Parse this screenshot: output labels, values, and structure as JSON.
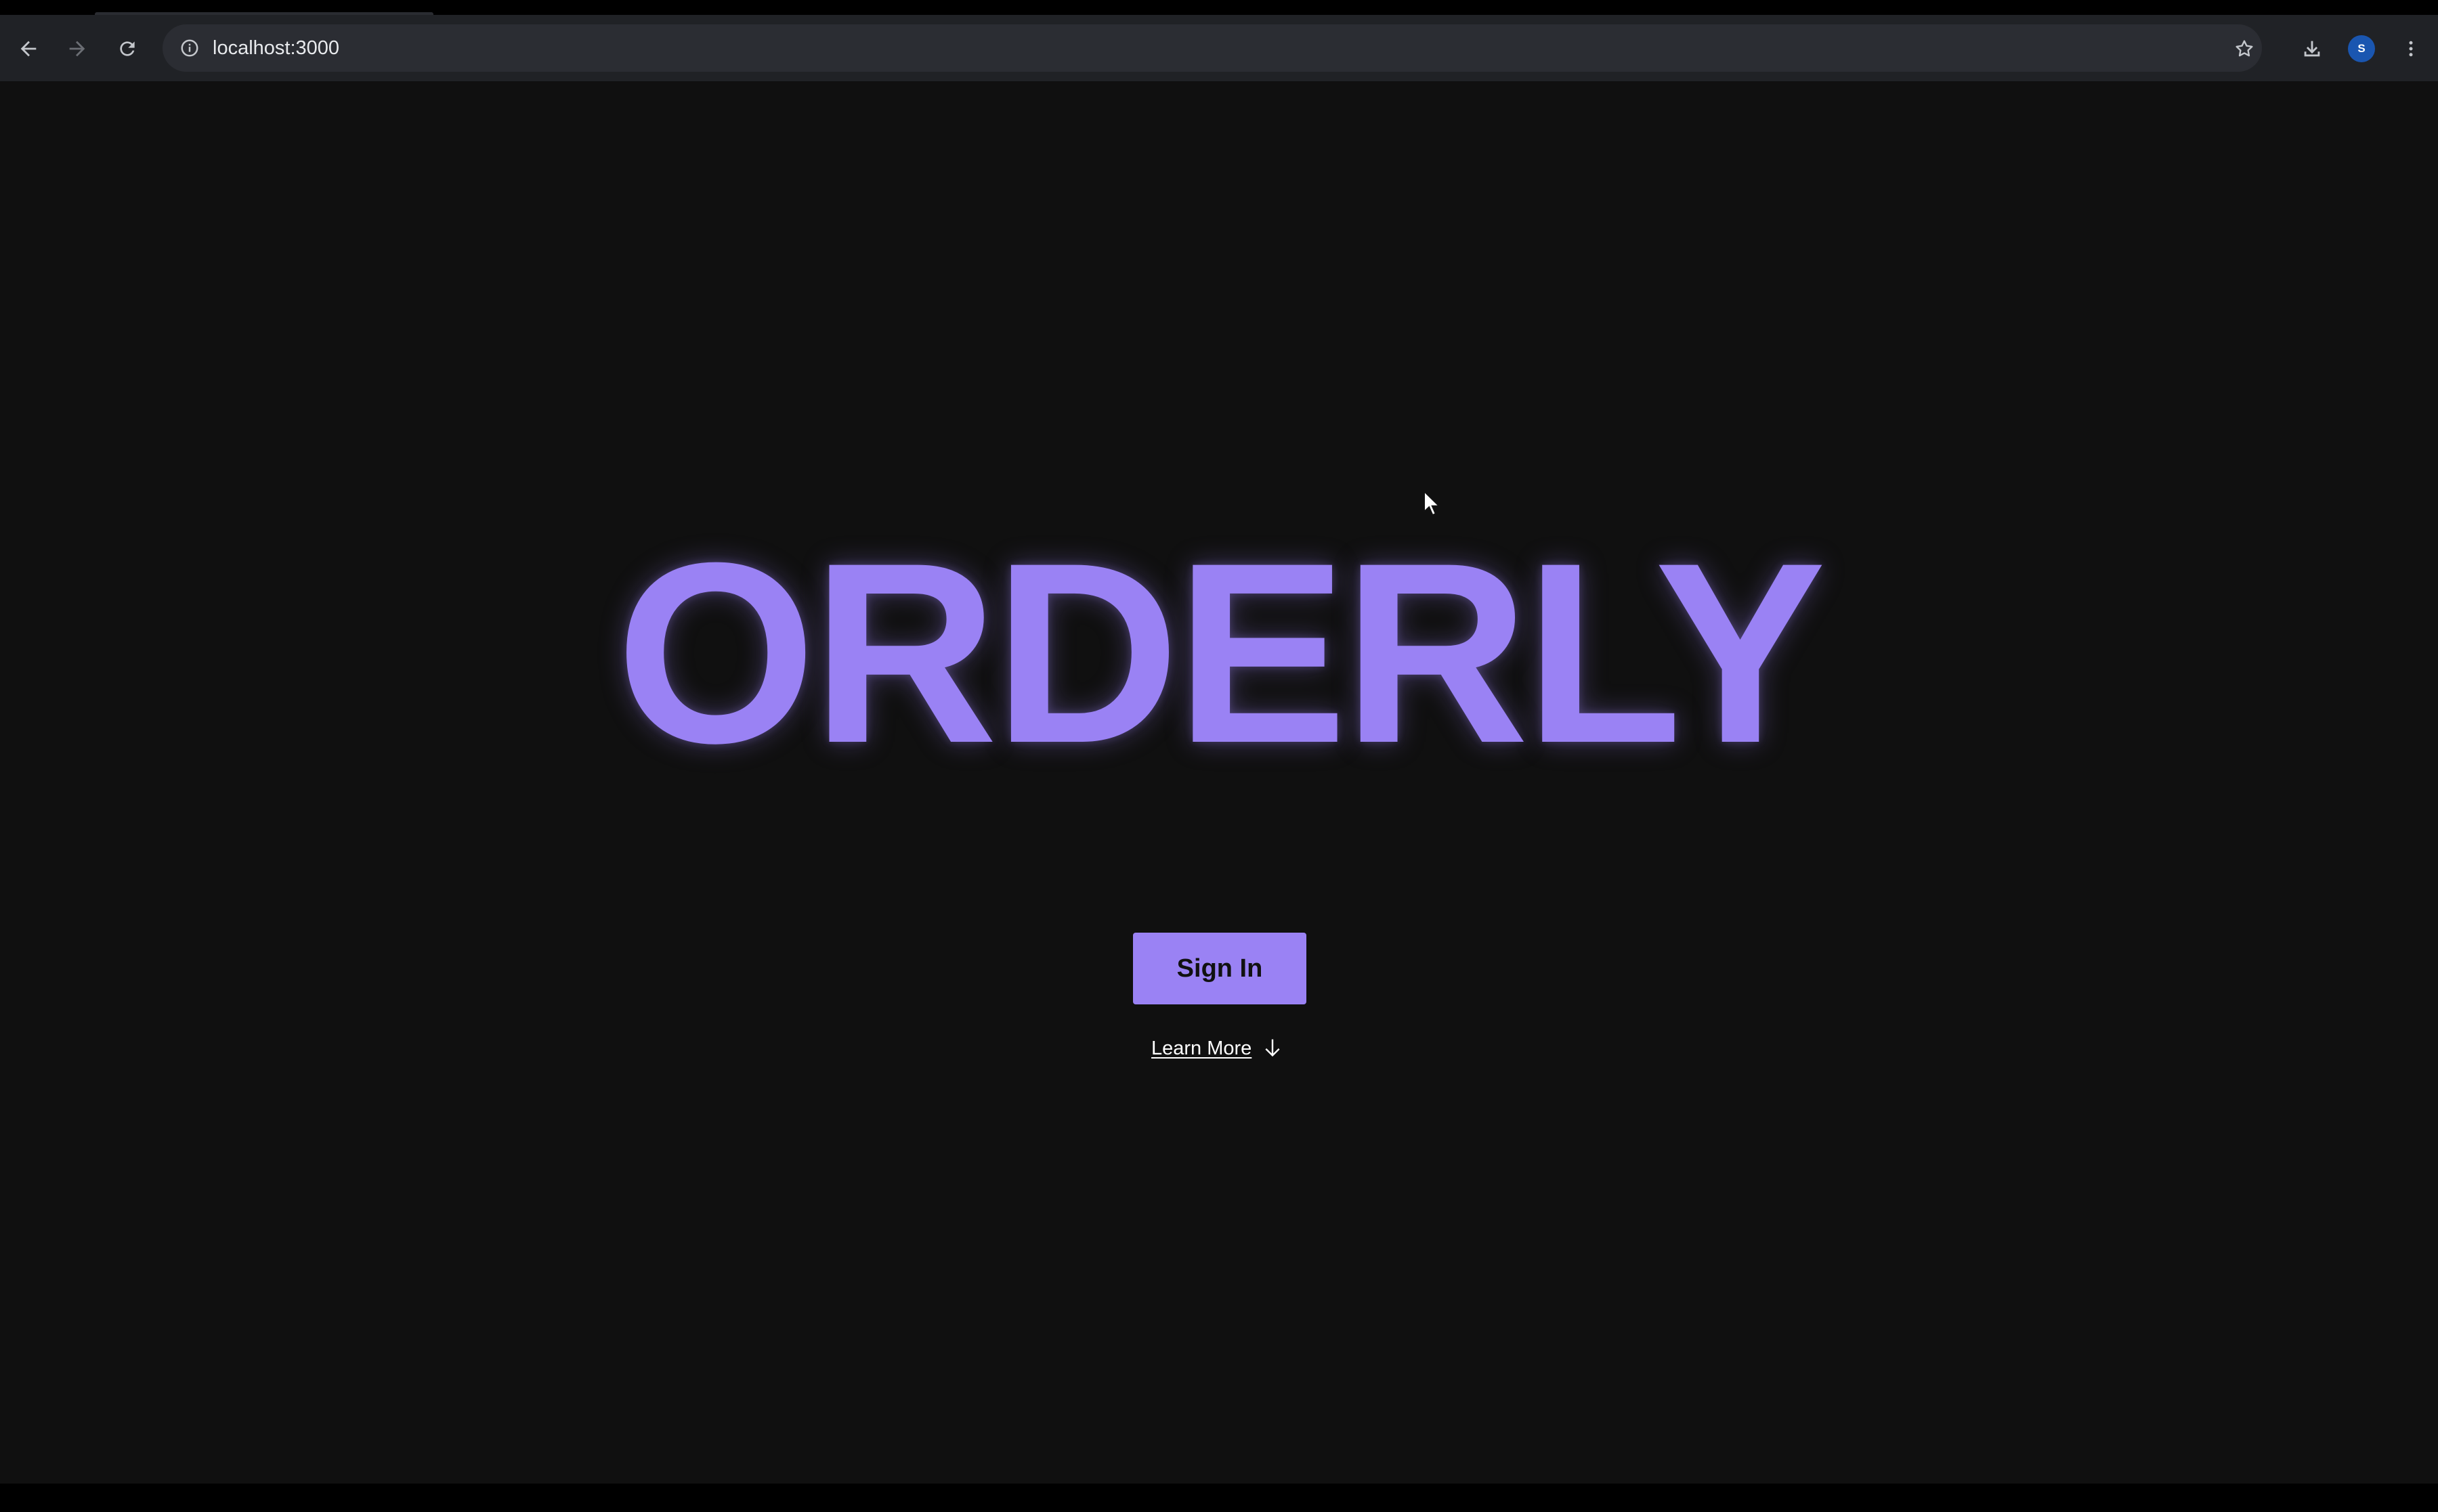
{
  "browser": {
    "url": "localhost:3000",
    "profile_initial": "S",
    "icons": {
      "back": "arrow-left-icon",
      "forward": "arrow-right-icon",
      "reload": "reload-icon",
      "site_info": "info-icon",
      "bookmark": "star-icon",
      "downloads": "download-icon",
      "menu": "kebab-menu-icon"
    }
  },
  "hero": {
    "logo_text": "ORDERLY",
    "sign_in_label": "Sign In",
    "learn_more_label": "Learn More",
    "learn_more_icon": "arrow-down-icon"
  },
  "colors": {
    "accent": "#9a82f4",
    "page_background": "#101010",
    "toolbar_background": "#202226",
    "profile_avatar": "#1a56b0"
  }
}
